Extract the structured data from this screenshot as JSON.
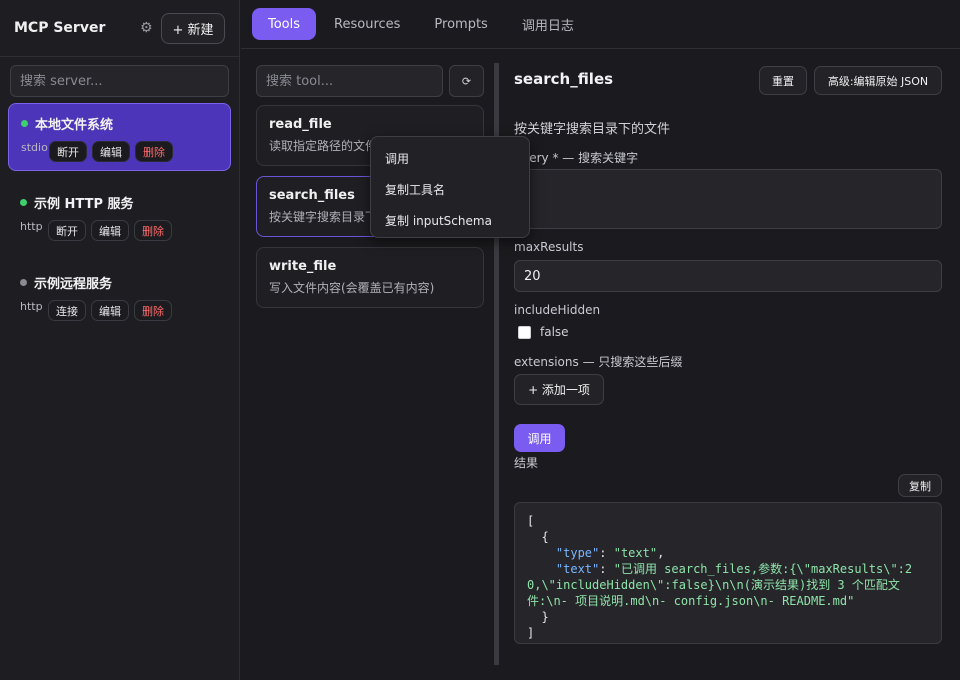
{
  "sidebar": {
    "title": "MCP Server",
    "new_label": "+ 新建",
    "search_placeholder": "搜索 server...",
    "servers": [
      {
        "name": "本地文件系统",
        "type": "stdio",
        "status_color": "#3ecf6e",
        "btn1": "断开",
        "btn2": "编辑",
        "btn3": "删除"
      },
      {
        "name": "示例 HTTP 服务",
        "type": "http",
        "status_color": "#3ecf6e",
        "btn1": "断开",
        "btn2": "编辑",
        "btn3": "删除"
      },
      {
        "name": "示例远程服务",
        "type": "http",
        "status_color": "#8a8a92",
        "btn1": "连接",
        "btn2": "编辑",
        "btn3": "删除"
      }
    ]
  },
  "tabs": [
    "Tools",
    "Resources",
    "Prompts",
    "调用日志"
  ],
  "tools": {
    "search_placeholder": "搜索 tool...",
    "refresh_icon": "⟳",
    "items": [
      {
        "name": "read_file",
        "desc": "读取指定路径的文件内容"
      },
      {
        "name": "search_files",
        "desc": "按关键字搜索目录下的文件"
      },
      {
        "name": "write_file",
        "desc": "写入文件内容(会覆盖已有内容)"
      }
    ]
  },
  "context_menu": [
    "调用",
    "复制工具名",
    "复制 inputSchema"
  ],
  "detail": {
    "title": "search_files",
    "reset_label": "重置",
    "json_label": "高级:编辑原始 JSON",
    "description": "按关键字搜索目录下的文件",
    "query_label": "query * — 搜索关键字",
    "query_value": "",
    "max_label": "maxResults",
    "max_value": "20",
    "hidden_label": "includeHidden",
    "hidden_value": "false",
    "ext_label": "extensions — 只搜索这些后缀",
    "add_label": "+ 添加一项",
    "invoke_label": "调用",
    "result_label": "结果",
    "copy_label": "复制",
    "result_json": {
      "bracket_open": "[",
      "brace_open": "{",
      "type_key": "\"type\"",
      "type_val": "\"text\"",
      "text_key": "\"text\"",
      "text_val_l1": "\"已调用 search_files,参数:{\\\"maxResults\\\":2",
      "text_val_l2": "0,\\\"includeHidden\\\":false}\\n\\n(演示结果)找到 3 个匹配文",
      "text_val_l3": "件:\\n- 项目说明.md\\n- config.json\\n- README.md\"",
      "brace_close": "}",
      "bracket_close": "]"
    }
  }
}
